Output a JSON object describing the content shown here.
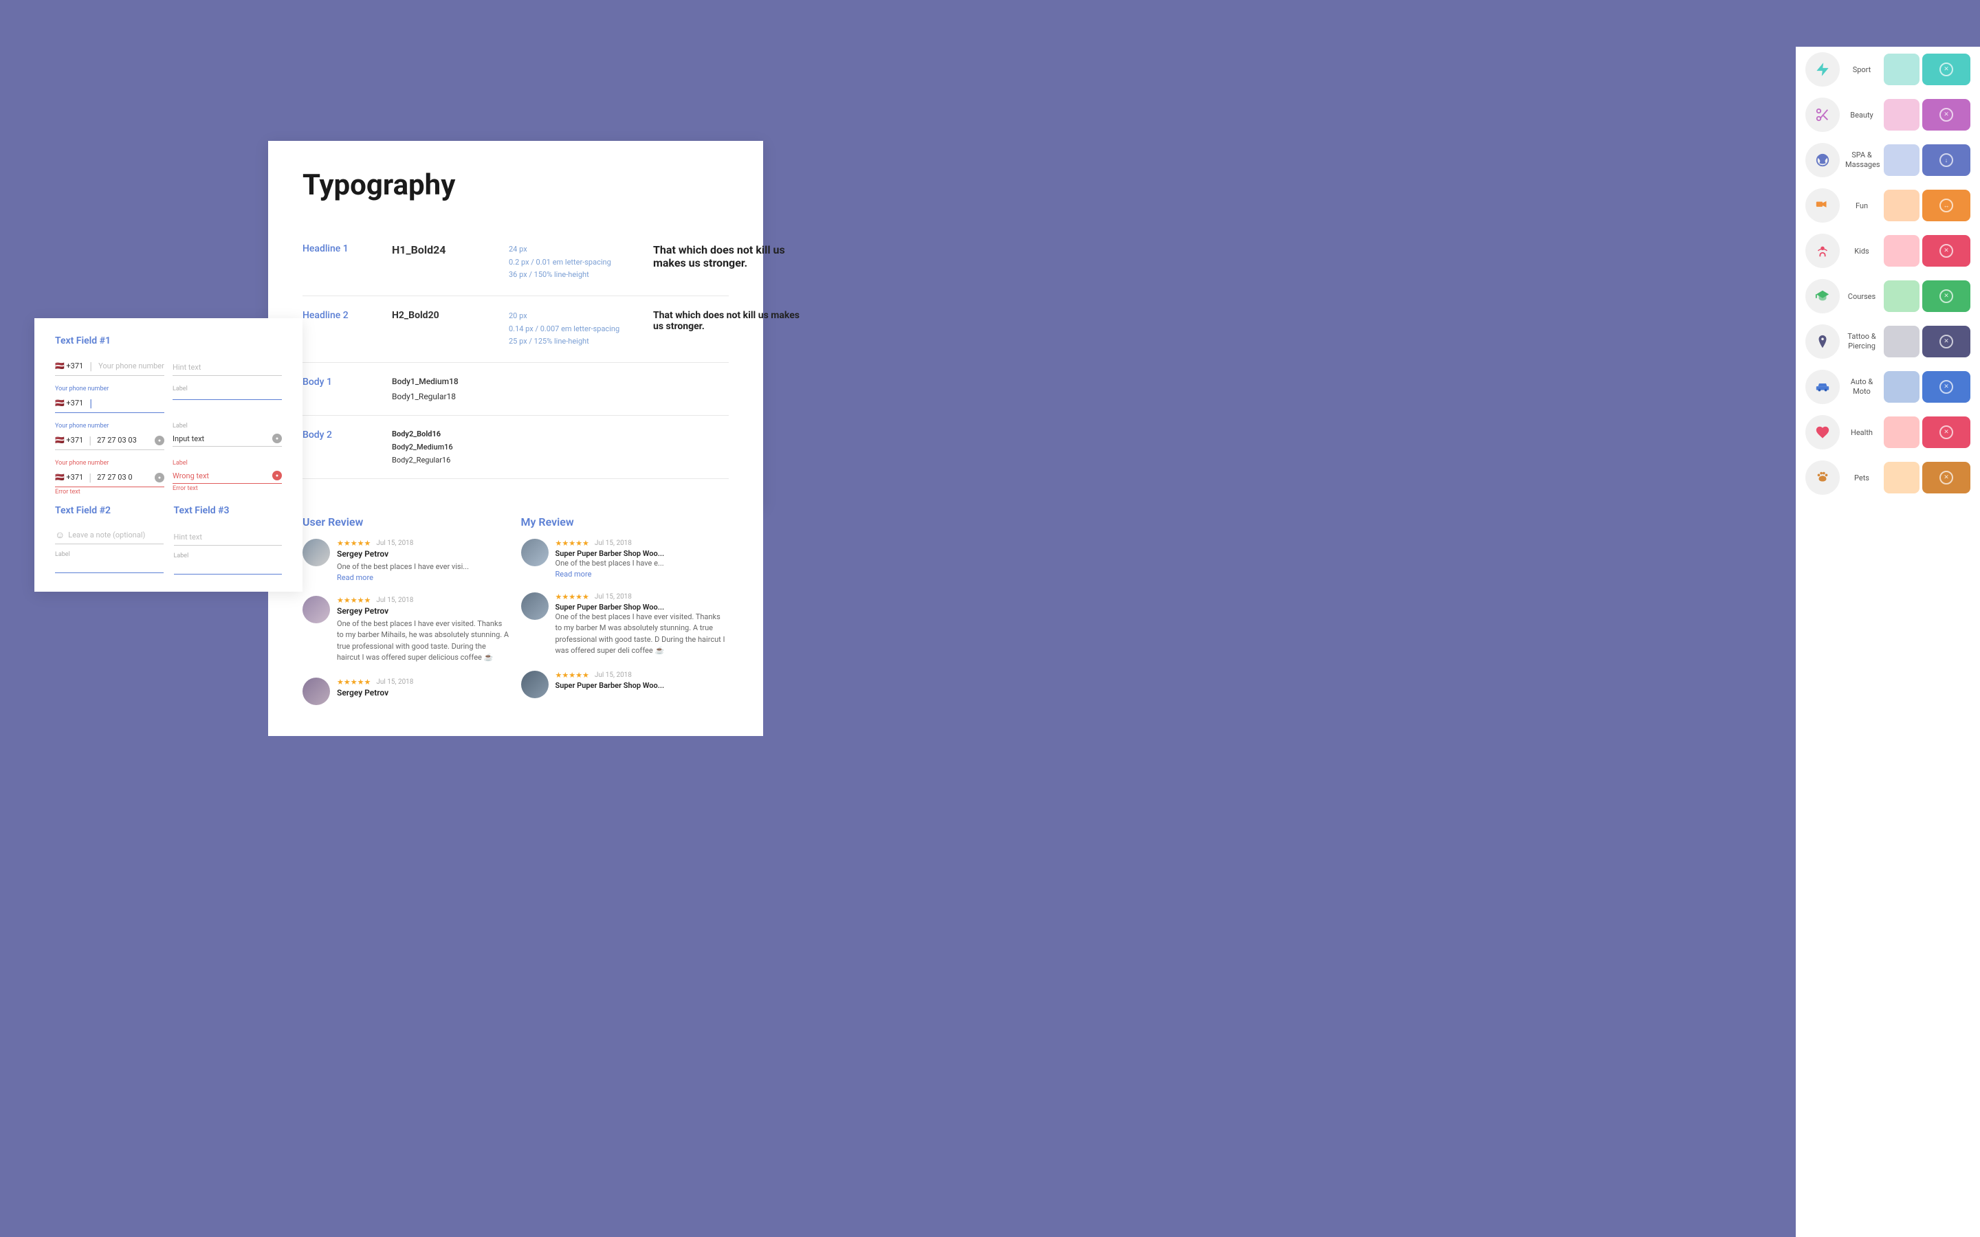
{
  "background": {
    "color": "#6b6fa8"
  },
  "typography": {
    "title": "Typography",
    "rows": [
      {
        "label": "Headline 1",
        "style": "H1_Bold24",
        "specs": [
          "24 px",
          "0.2 px / 0.01 em letter-spacing",
          "36 px / 150% line-height"
        ],
        "preview": "That which does not kill us makes us stronger."
      },
      {
        "label": "Headline 2",
        "style": "H2_Bold20",
        "specs": [
          "20 px",
          "0.14 px / 0.007 em letter-spacing",
          "25 px / 125% line-height"
        ],
        "preview": "That which does not kill us makes us stronger."
      },
      {
        "label": "Body 1",
        "style_a": "Body1_Medium18",
        "style_b": "Body1_Regular18"
      },
      {
        "label": "Body 2",
        "style_a": "Body2_Bold16",
        "style_b": "Body2_Medium16",
        "style_c": "Body2_Regular16"
      }
    ]
  },
  "reviews": {
    "user_review_title": "User Review",
    "my_review_title": "My Review",
    "items": [
      {
        "stars": "★★★★★",
        "date": "Jul 15, 2018",
        "name": "Sergey Petrov",
        "text": "One of the best places I have ever visi...",
        "read_more": "Read more"
      },
      {
        "stars": "★★★★★",
        "date": "Jul 15, 2018",
        "shop": "Super Puper Barber Shop Woo...",
        "text": "One of the best places I have e...",
        "read_more": "Read more"
      },
      {
        "stars": "★★★★★",
        "date": "Jul 15, 2018",
        "name": "Sergey Petrov",
        "text": "One of the best places I have ever visited. Thanks to my barber Mihails, he was absolutely stunning. A true professional with good taste. During the haircut I was offered super delicious coffee ☕"
      },
      {
        "stars": "★★★★★",
        "date": "Jul 15, 2018",
        "shop": "Super Puper Barber Shop Woo...",
        "text": "One of the best places I have ever visited. Thanks to my barber M was absolutely stunning. A true professional with good taste. D During the haircut I was offered super deli coffee ☕"
      },
      {
        "stars": "★★★★★",
        "date": "Jul 15, 2018",
        "name": "Sergey Petrov"
      },
      {
        "stars": "★★★★★",
        "date": "Jul 15, 2018",
        "shop": "Super Puper Barber Shop Woo..."
      }
    ]
  },
  "textfields": {
    "section1_title": "Text Field #1",
    "section2_title": "Text Field #2",
    "section3_title": "Text Field #3",
    "country_code": "+371",
    "placeholder": "Your phone number",
    "hint_text": "Hint text",
    "label": "Label",
    "input_text": "Input text",
    "wrong_text": "Wrong text",
    "error_text": "Error text",
    "leave_note": "Leave a note (optional)",
    "your_phone_label": "Your phone number"
  },
  "sidebar": {
    "categories": [
      {
        "name": "Sport",
        "icon": "⚡",
        "color_light": "#b2e8e0",
        "color_dark": "#4ecdc4",
        "swatch_icon": "✕"
      },
      {
        "name": "Beauty",
        "icon": "✂",
        "color_light": "#f5c6e0",
        "color_dark": "#c06bc4",
        "swatch_icon": "✕"
      },
      {
        "name": "SPA &\nMassages",
        "icon": "🌿",
        "color_light": "#c8d4f0",
        "color_dark": "#6477c4",
        "swatch_icon": "⬇"
      },
      {
        "name": "Fun",
        "icon": "🎭",
        "color_light": "#ffd4b0",
        "color_dark": "#f0903a",
        "swatch_icon": "↔"
      },
      {
        "name": "Kids",
        "icon": "👶",
        "color_light": "#ffc4cc",
        "color_dark": "#e84c6a",
        "swatch_icon": "✕"
      },
      {
        "name": "Courses",
        "icon": "🎓",
        "color_light": "#b4e8c0",
        "color_dark": "#45b86a",
        "swatch_icon": "✕"
      },
      {
        "name": "Tattoo &\nPiercing",
        "icon": "💉",
        "color_light": "#d0d0d8",
        "color_dark": "#555580",
        "swatch_icon": "✕"
      },
      {
        "name": "Auto &\nMoto",
        "icon": "🚗",
        "color_light": "#b4c8e8",
        "color_dark": "#4a7ad4",
        "swatch_icon": "✕"
      },
      {
        "name": "Health",
        "icon": "❤",
        "color_light": "#ffc4c4",
        "color_dark": "#e84c6a",
        "swatch_icon": "✕"
      }
    ]
  }
}
